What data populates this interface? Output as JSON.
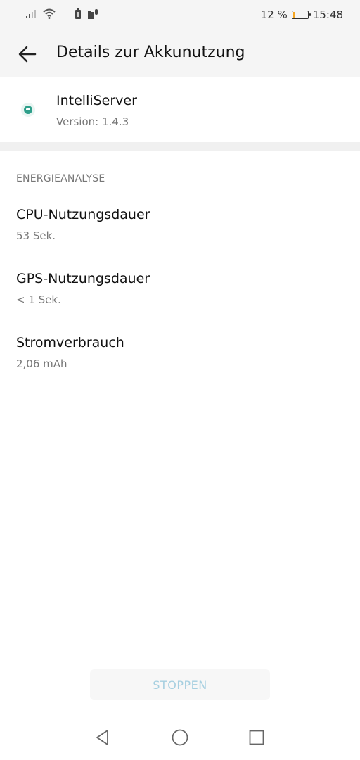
{
  "status_bar": {
    "battery_percent": "12 %",
    "battery_level": 0.12,
    "time": "15:48",
    "icons": [
      "signal-icon",
      "wifi-icon",
      "battery-saver-icon",
      "notification-icon"
    ]
  },
  "app_bar": {
    "title": "Details zur Akkunutzung",
    "back_icon": "arrow-left-icon"
  },
  "app_info": {
    "name": "IntelliServer",
    "version": "Version: 1.4.3",
    "icon": "app-icon"
  },
  "section": {
    "header": "ENERGIEANALYSE",
    "items": [
      {
        "title": "CPU-Nutzungsdauer",
        "value": "53 Sek."
      },
      {
        "title": "GPS-Nutzungsdauer",
        "value": "< 1 Sek."
      },
      {
        "title": "Stromverbrauch",
        "value": "2,06 mAh"
      }
    ]
  },
  "actions": {
    "stop_label": "STOPPEN"
  },
  "nav": {
    "icons": [
      "nav-back-icon",
      "nav-home-icon",
      "nav-recents-icon"
    ]
  },
  "colors": {
    "accent_disabled": "#a6cfe0",
    "battery_low": "#f5a623",
    "app_icon": "#2e9f8a"
  }
}
